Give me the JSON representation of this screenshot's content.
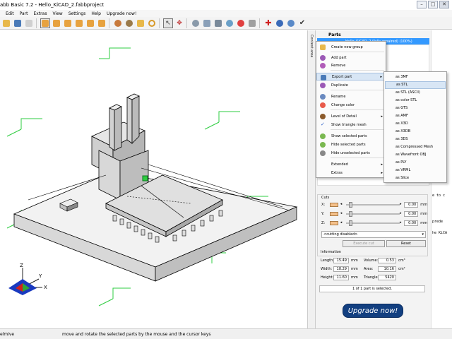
{
  "window": {
    "title": "abb Basic 7.2 - Hello_KiCAD_2.fabbproject",
    "buttons": [
      "–",
      "□",
      "✕"
    ]
  },
  "menu": [
    "Edit",
    "Part",
    "Extras",
    "View",
    "Settings",
    "Help",
    "Upgrade now!"
  ],
  "colors": {
    "selection": "#3399ff",
    "upgrade_button": "#123f80",
    "cut_swatch": "#f4c08a",
    "axis_green": "#2ecc40"
  },
  "toolbar_icons": [
    "open-icon",
    "save-icon",
    "undo-icon",
    "view-front-icon",
    "view-back-icon",
    "view-left-icon",
    "view-right-icon",
    "view-top-icon",
    "view-bottom-icon",
    "palette-icon",
    "material-icon",
    "measure-icon",
    "search-icon",
    "select-arrow-icon",
    "move-icon",
    "settings-icon",
    "layers-icon",
    "paint-icon",
    "shape-icon",
    "color-icon",
    "add-icon",
    "compass-icon",
    "info-icon",
    "check-icon"
  ],
  "side_tab": "Context area",
  "parts": {
    "header": "Parts",
    "selected_part": "Hello_KiCAD_2 (fully repaired) (100%)"
  },
  "context_menu": {
    "items": [
      {
        "label": "Create new group",
        "icon": "folder-icon",
        "color": "#e8b84a"
      },
      {
        "label": "Add part",
        "icon": "add-part-icon",
        "color": "#9b59b6"
      },
      {
        "label": "Remove",
        "icon": "remove-icon",
        "color": "#b05cb8"
      },
      {
        "label": "Export part",
        "icon": "export-icon",
        "color": "#4a7ab8",
        "submenu": true
      },
      {
        "label": "Duplicate",
        "icon": "duplicate-icon",
        "color": "#9b59b6"
      },
      {
        "label": "Rename",
        "icon": "rename-icon",
        "color": "#6a8ac0"
      },
      {
        "label": "Change color",
        "icon": "color-icon",
        "color": "#e85a4a"
      },
      {
        "label": "Level of Detail",
        "icon": "lod-icon",
        "color": "#8b5a2b",
        "submenu": true
      },
      {
        "label": "Show triangle mesh",
        "icon": "check-icon",
        "color": "#3366cc"
      },
      {
        "label": "Show selected parts",
        "icon": "show-icon",
        "color": "#7ab850"
      },
      {
        "label": "Hide selected parts",
        "icon": "hide-icon",
        "color": "#7ab850"
      },
      {
        "label": "Hide unselected parts",
        "icon": "hide-unselected-icon",
        "color": "#888888"
      },
      {
        "label": "Extended",
        "icon": "",
        "color": "",
        "submenu": true
      },
      {
        "label": "Extras",
        "icon": "",
        "color": "",
        "submenu": true
      }
    ]
  },
  "export_submenu": [
    "as 3MF",
    "as STL",
    "as STL (ASCII)",
    "as color STL",
    "as GTS",
    "as AMF",
    "as X3D",
    "as X3DB",
    "as 3DS",
    "as Compressed Mesh",
    "as Wavefront OBJ",
    "as PLY",
    "as VRML",
    "as Slice"
  ],
  "cuts": {
    "title": "Cuts",
    "axes": [
      {
        "label": "X:",
        "value": "0.00",
        "unit": "mm"
      },
      {
        "label": "Y:",
        "value": "0.00",
        "unit": "mm"
      },
      {
        "label": "Z:",
        "value": "0.00",
        "unit": "mm"
      }
    ],
    "mode": "<cutting disabled>",
    "execute_label": "Execute cut",
    "reset_label": "Reset"
  },
  "information": {
    "title": "Information",
    "length_label": "Length:",
    "length": "15.49",
    "length_unit": "mm",
    "volume_label": "Volume:",
    "volume": "0.53",
    "volume_unit": "cm³",
    "width_label": "Width:",
    "width": "18.29",
    "width_unit": "mm",
    "area_label": "Area:",
    "area": "10.16",
    "area_unit": "cm²",
    "height_label": "Height:",
    "height": "11.60",
    "height_unit": "mm",
    "triangles_label": "Triangles:",
    "triangles": "5420",
    "selection_text": "1 of 1 part is selected."
  },
  "upgrade_label": "Upgrade now!",
  "right_strip": [
    "e to c",
    "prede",
    "he KiCA"
  ],
  "status": {
    "left": "elmive",
    "message": "move and rotate the selected parts by the mouse and the cursor keys"
  },
  "axes_labels": [
    "Z",
    "Y",
    "X"
  ]
}
